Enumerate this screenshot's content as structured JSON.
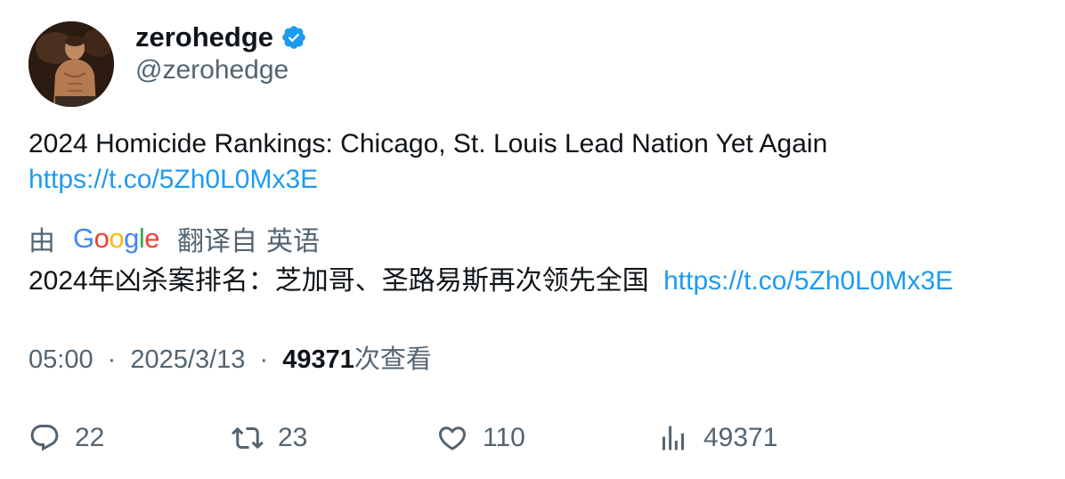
{
  "author": {
    "display_name": "zerohedge",
    "handle": "@zerohedge",
    "verified": true,
    "avatar_icon": "avatar-photo"
  },
  "tweet": {
    "text": "2024 Homicide Rankings: Chicago, St. Louis Lead Nation Yet Again",
    "link": "https://t.co/5Zh0L0Mx3E"
  },
  "translation": {
    "by_label": "由",
    "provider": "Google",
    "from_label": "翻译自",
    "source_language": "英语",
    "text": "2024年凶杀案排名：芝加哥、圣路易斯再次领先全国",
    "link": "https://t.co/5Zh0L0Mx3E"
  },
  "meta": {
    "time": "05:00",
    "separator": "·",
    "date": "2025/3/13",
    "views": "49371",
    "views_label": "次查看"
  },
  "actions": {
    "reply_count": "22",
    "retweet_count": "23",
    "like_count": "110",
    "views_count": "49371"
  },
  "colors": {
    "link": "#1d9bf0",
    "verified_badge": "#1d9bf0",
    "secondary_text": "#536471",
    "primary_text": "#0f1419"
  }
}
